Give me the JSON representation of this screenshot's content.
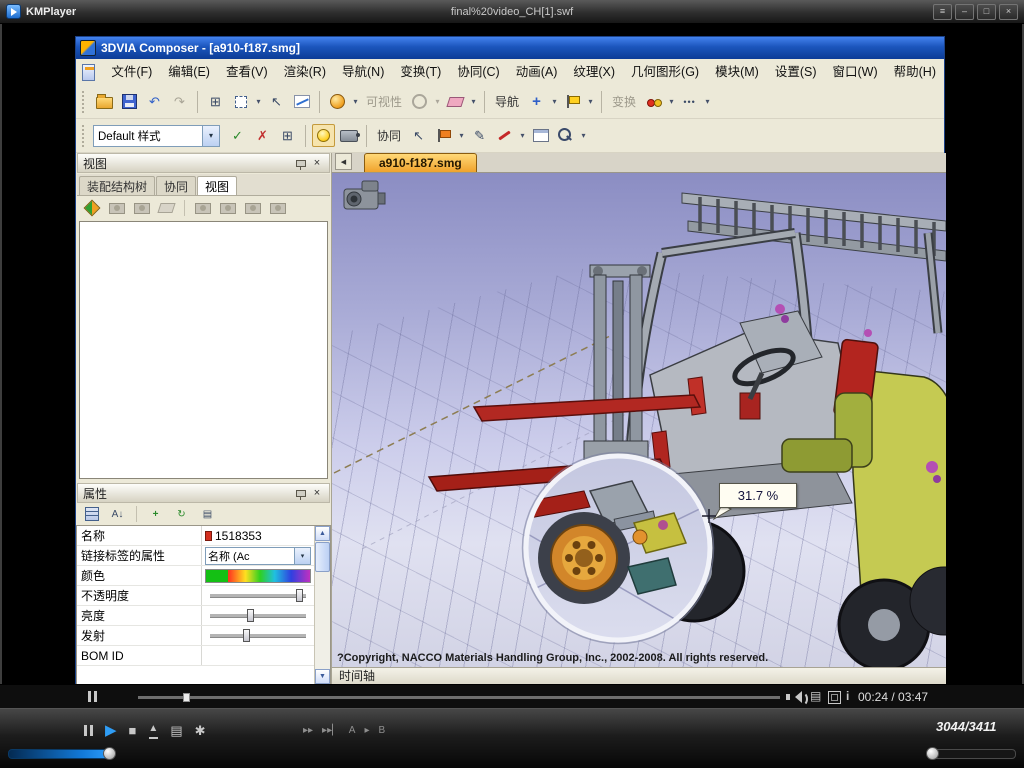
{
  "player": {
    "app_name": "KMPlayer",
    "media_title": "final%20video_CH[1].swf",
    "time_display": "00:24 / 03:47",
    "frame_counter": "3044/3411",
    "seek_pct": 7.5,
    "volume_pct": 96,
    "pan_pct": 3,
    "ab_a": "A",
    "ab_b": "B"
  },
  "icons": {
    "menu": "≡",
    "minimize": "–",
    "maximize": "□",
    "close": "×",
    "play": "▶",
    "stop": "■",
    "eject": "▲",
    "playlist": "▤",
    "settings": "✱",
    "ff1": "▸▸",
    "ff2": "▸▸▏",
    "arrow_small": "▸",
    "info": "i",
    "panel_close": "×",
    "undo": "↶",
    "redo": "↷",
    "grid": "⊞",
    "pointer": "↖",
    "check": "✓",
    "cross": "✗",
    "dots": "•••",
    "pencil": "✎",
    "sort": "A↓",
    "refresh": "↻",
    "plus": "+",
    "tab_left": "◀",
    "combo_arrow": "▾",
    "scroll_up": "▲",
    "scroll_down": "▼"
  },
  "colors": {
    "composer_titlebar_blue": "#1b55bc",
    "active_doc_tab_orange": "#f0a22c",
    "fork_red": "#b22822",
    "counterweight_yellow": "#c5ca52",
    "scene_purple": "#8b8dc3"
  },
  "composer": {
    "title": "3DVIA Composer - [a910-f187.smg]",
    "menus": [
      {
        "label": "文件(F)"
      },
      {
        "label": "编辑(E)"
      },
      {
        "label": "查看(V)"
      },
      {
        "label": "渲染(R)"
      },
      {
        "label": "导航(N)"
      },
      {
        "label": "变换(T)"
      },
      {
        "label": "协同(C)"
      },
      {
        "label": "动画(A)"
      },
      {
        "label": "纹理(X)"
      },
      {
        "label": "几何图形(G)"
      },
      {
        "label": "模块(M)"
      },
      {
        "label": "设置(S)"
      },
      {
        "label": "窗口(W)"
      },
      {
        "label": "帮助(H)"
      }
    ],
    "toolbar": {
      "style_preset": "Default 样式",
      "visibility_label": "可视性",
      "navigate_label": "导航",
      "transform_label": "变换",
      "collaborate_label": "协同"
    },
    "view_panel": {
      "title": "视图",
      "tabs": [
        {
          "label": "装配结构树"
        },
        {
          "label": "协同"
        },
        {
          "label": "视图"
        }
      ]
    },
    "props_panel": {
      "title": "属性",
      "name_label": "名称",
      "name_value": "1518353",
      "link_label": "链接标签的属性",
      "link_value": "名称 (Ac",
      "color_label": "颜色",
      "opacity_label": "不透明度",
      "opacity_pct": 93,
      "brightness_label": "亮度",
      "brightness_pct": 42,
      "emission_label": "发射",
      "emission_pct": 38,
      "bom_label": "BOM ID",
      "bom_value": ""
    },
    "viewport": {
      "doc_tab": "a910-f187.smg",
      "zoom_value": "31.7 %",
      "copyright": "?Copyright, NACCO Materials Handling Group, Inc., 2002-2008. All rights reserved.",
      "timeline_label": "时间轴"
    }
  }
}
